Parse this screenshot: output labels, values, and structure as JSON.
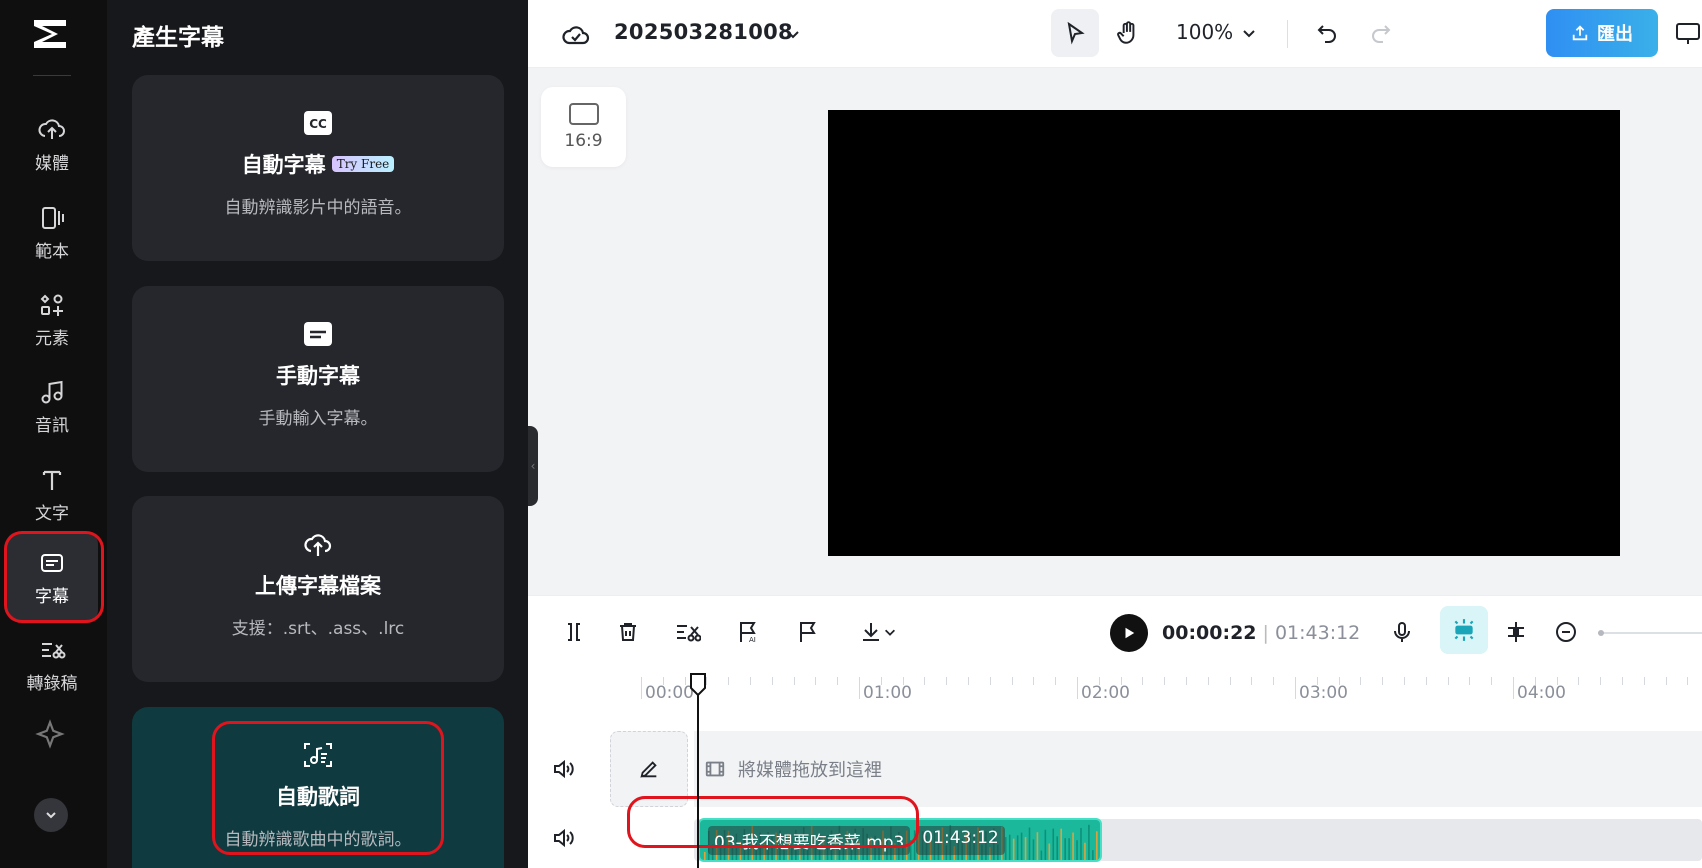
{
  "rail": {
    "items": [
      {
        "label": "媒體",
        "icon": "cloud-upload-icon"
      },
      {
        "label": "範本",
        "icon": "template-icon"
      },
      {
        "label": "元素",
        "icon": "elements-icon"
      },
      {
        "label": "音訊",
        "icon": "music-note-icon"
      },
      {
        "label": "文字",
        "icon": "text-t-icon"
      },
      {
        "label": "字幕",
        "icon": "captions-icon"
      },
      {
        "label": "轉錄稿",
        "icon": "transcript-icon"
      }
    ],
    "active_index": 5
  },
  "panel": {
    "title": "產生字幕",
    "cards": [
      {
        "title": "自動字幕",
        "badge": "Try Free",
        "desc": "自動辨識影片中的語音。",
        "icon": "cc-icon"
      },
      {
        "title": "手動字幕",
        "desc": "手動輸入字幕。",
        "icon": "subtitle-box-icon"
      },
      {
        "title": "上傳字幕檔案",
        "desc": "支援：.srt、.ass、.lrc",
        "icon": "cloud-upload-icon"
      },
      {
        "title": "自動歌詞",
        "desc": "自動辨識歌曲中的歌詞。",
        "icon": "music-lyrics-icon"
      }
    ]
  },
  "topbar": {
    "project_name": "202503281008",
    "zoom": "100%",
    "export_label": "匯出"
  },
  "canvas": {
    "ratio_label": "16:9"
  },
  "timeline": {
    "current_time": "00:00:22",
    "separator": "|",
    "total_time": "01:43:12",
    "ruler_labels": [
      "00:00",
      "01:00",
      "02:00",
      "03:00",
      "04:00"
    ],
    "drop_zone_text": "將媒體拖放到這裡",
    "clip": {
      "name": "03-我不想要吃香菜.mp3",
      "duration": "01:43:12"
    }
  },
  "colors": {
    "accent_blue": "#2f8ff3",
    "clip_teal": "#1bb89c",
    "highlight_red": "#e0141c",
    "lyrics_card": "#0f3a3f"
  }
}
